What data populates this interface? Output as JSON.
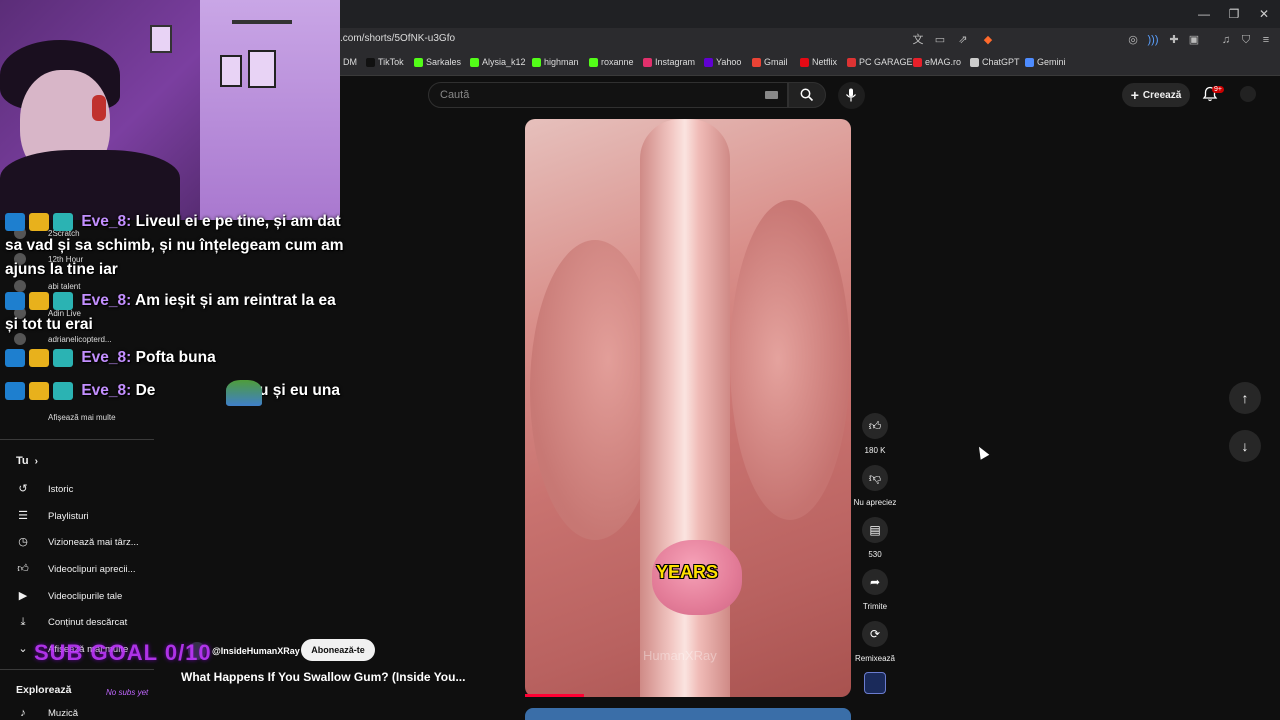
{
  "browser": {
    "url": ".com/shorts/5OfNK-u3Gfo",
    "bookmarks": [
      {
        "label": "DM",
        "color": "#4a4a4a"
      },
      {
        "label": "TikTok",
        "color": "#111111"
      },
      {
        "label": "Sarkales",
        "color": "#53fc18"
      },
      {
        "label": "Alysia_k12",
        "color": "#53fc18"
      },
      {
        "label": "highman",
        "color": "#53fc18"
      },
      {
        "label": "roxanne",
        "color": "#53fc18"
      },
      {
        "label": "Instagram",
        "color": "#e1306c"
      },
      {
        "label": "Yahoo",
        "color": "#6001d2"
      },
      {
        "label": "Gmail",
        "color": "#ea4335"
      },
      {
        "label": "Netflix",
        "color": "#e50914"
      },
      {
        "label": "PC GARAGE",
        "color": "#d33"
      },
      {
        "label": "eMAG.ro",
        "color": "#e8202a"
      },
      {
        "label": "ChatGPT",
        "color": "#cccccc"
      },
      {
        "label": "Gemini",
        "color": "#4e8cff"
      }
    ]
  },
  "header": {
    "search_placeholder": "Caută",
    "create_label": "Creează",
    "notif_badge": "9+"
  },
  "sidebar": {
    "subscriptions": [
      {
        "label": "2Scratch"
      },
      {
        "label": "12th Hour"
      },
      {
        "label": "abi talent"
      },
      {
        "label": "Adin Live"
      },
      {
        "label": "adrianelicopterd..."
      }
    ],
    "show_more_subs": "Afișează mai multe",
    "you_section": "Tu",
    "you_items": [
      {
        "label": "Istoric",
        "icon": "history-icon"
      },
      {
        "label": "Playlisturi",
        "icon": "playlist-icon"
      },
      {
        "label": "Vizionează mai târz...",
        "icon": "clock-icon"
      },
      {
        "label": "Videoclipuri aprecii...",
        "icon": "thumb-up-icon"
      },
      {
        "label": "Videoclipurile tale",
        "icon": "play-square-icon"
      },
      {
        "label": "Conținut descărcat",
        "icon": "download-icon"
      },
      {
        "label": "Afișează mai multe",
        "icon": "chevron-down-icon"
      }
    ],
    "explore_title": "Explorează",
    "explore_items": [
      {
        "label": "Muzică",
        "icon": "music-icon"
      }
    ]
  },
  "chat": [
    {
      "user": "Eve_8:",
      "text": "Liveul ei e pe tine, și am dat sa vad și sa schimb, și nu înțelegeam cum am ajuns la tine iar"
    },
    {
      "user": "Eve_8:",
      "text": "Am ieșit și am reintrat la ea și tot tu erai"
    },
    {
      "user": "Eve_8:",
      "text": "Pofta buna"
    },
    {
      "user": "Eve_8:",
      "text": "De",
      "text2": "iau și eu una"
    }
  ],
  "overlay": {
    "sub_goal": "SUB GOAL 0/10",
    "no_subs": "No subs yet"
  },
  "video": {
    "caption": "YEARS",
    "watermark": "HumanXRay",
    "channel": "@InsideHumanXRay",
    "subscribe_label": "Abonează-te",
    "title": "What Happens If You Swallow Gum? (Inside You...",
    "progress": 0.18
  },
  "actions": {
    "likes": "180 K",
    "dislike_label": "Nu apreciez",
    "comments": "530",
    "share_label": "Trimite",
    "remix_label": "Remixează"
  }
}
